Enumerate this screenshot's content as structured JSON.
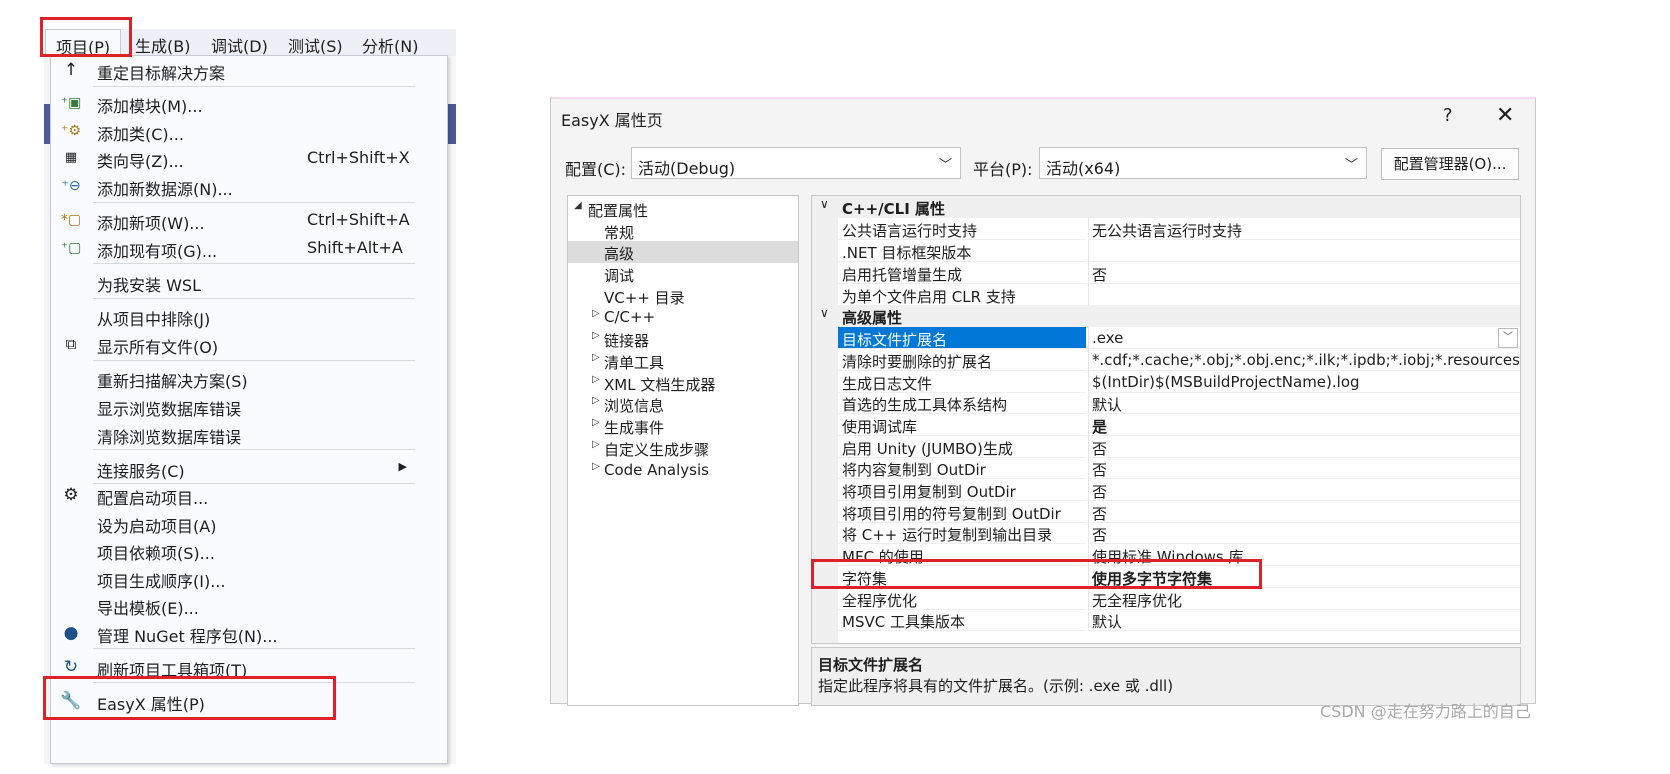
{
  "menubar": {
    "items": [
      "项目(P)",
      "生成(B)",
      "调试(D)",
      "测试(S)",
      "分析(N)"
    ]
  },
  "menu": {
    "items": [
      {
        "label": "重定目标解决方案",
        "shortcut": "",
        "icon": "arrow-up-icon"
      },
      {
        "label": "添加模块(M)...",
        "shortcut": "",
        "icon": "add-module-icon"
      },
      {
        "label": "添加类(C)...",
        "shortcut": "",
        "icon": "add-class-icon"
      },
      {
        "label": "类向导(Z)...",
        "shortcut": "Ctrl+Shift+X",
        "icon": "class-wizard-icon"
      },
      {
        "label": "添加新数据源(N)...",
        "shortcut": "",
        "icon": "add-datasource-icon"
      },
      {
        "label": "添加新项(W)...",
        "shortcut": "Ctrl+Shift+A",
        "icon": "add-new-item-icon"
      },
      {
        "label": "添加现有项(G)...",
        "shortcut": "Shift+Alt+A",
        "icon": "add-existing-item-icon"
      },
      {
        "label": "为我安装 WSL",
        "shortcut": "",
        "icon": ""
      },
      {
        "label": "从项目中排除(J)",
        "shortcut": "",
        "icon": ""
      },
      {
        "label": "显示所有文件(O)",
        "shortcut": "",
        "icon": "show-all-files-icon"
      },
      {
        "label": "重新扫描解决方案(S)",
        "shortcut": "",
        "icon": ""
      },
      {
        "label": "显示浏览数据库错误",
        "shortcut": "",
        "icon": ""
      },
      {
        "label": "清除浏览数据库错误",
        "shortcut": "",
        "icon": ""
      },
      {
        "label": "连接服务(C)",
        "shortcut": "",
        "icon": ""
      },
      {
        "label": "配置启动项目...",
        "shortcut": "",
        "icon": "gear-icon"
      },
      {
        "label": "设为启动项目(A)",
        "shortcut": "",
        "icon": ""
      },
      {
        "label": "项目依赖项(S)...",
        "shortcut": "",
        "icon": ""
      },
      {
        "label": "项目生成顺序(I)...",
        "shortcut": "",
        "icon": ""
      },
      {
        "label": "导出模板(E)...",
        "shortcut": "",
        "icon": ""
      },
      {
        "label": "管理 NuGet 程序包(N)...",
        "shortcut": "",
        "icon": "nuget-icon"
      },
      {
        "label": "刷新项目工具箱项(T)",
        "shortcut": "",
        "icon": "refresh-icon"
      },
      {
        "label": "EasyX 属性(P)",
        "shortcut": "",
        "icon": "wrench-icon"
      }
    ]
  },
  "dialog": {
    "title": "EasyX 属性页",
    "help": "?",
    "close": "✕",
    "config_label": "配置(C):",
    "config_value": "活动(Debug)",
    "platform_label": "平台(P):",
    "platform_value": "活动(x64)",
    "config_manager": "配置管理器(O)...",
    "tree": [
      {
        "label": "配置属性",
        "expander": "◢"
      },
      {
        "label": "常规",
        "expander": ""
      },
      {
        "label": "高级",
        "expander": ""
      },
      {
        "label": "调试",
        "expander": ""
      },
      {
        "label": "VC++ 目录",
        "expander": ""
      },
      {
        "label": "C/C++",
        "expander": "▷"
      },
      {
        "label": "链接器",
        "expander": "▷"
      },
      {
        "label": "清单工具",
        "expander": "▷"
      },
      {
        "label": "XML 文档生成器",
        "expander": "▷"
      },
      {
        "label": "浏览信息",
        "expander": "▷"
      },
      {
        "label": "生成事件",
        "expander": "▷"
      },
      {
        "label": "自定义生成步骤",
        "expander": "▷"
      },
      {
        "label": "Code Analysis",
        "expander": "▷"
      }
    ],
    "grid": {
      "cat1": "C++/CLI 属性",
      "cat1_rows": [
        {
          "name": "公共语言运行时支持",
          "value": "无公共语言运行时支持"
        },
        {
          "name": ".NET 目标框架版本",
          "value": ""
        },
        {
          "name": "启用托管增量生成",
          "value": "否"
        },
        {
          "name": "为单个文件启用 CLR 支持",
          "value": ""
        }
      ],
      "cat2": "高级属性",
      "cat2_rows": [
        {
          "name": "目标文件扩展名",
          "value": ".exe"
        },
        {
          "name": "清除时要删除的扩展名",
          "value": "*.cdf;*.cache;*.obj;*.obj.enc;*.ilk;*.ipdb;*.iobj;*.resources;*.tlb;*"
        },
        {
          "name": "生成日志文件",
          "value": "$(IntDir)$(MSBuildProjectName).log"
        },
        {
          "name": "首选的生成工具体系结构",
          "value": "默认"
        },
        {
          "name": "使用调试库",
          "value": "是"
        },
        {
          "name": "启用 Unity (JUMBO)生成",
          "value": "否"
        },
        {
          "name": "将内容复制到 OutDir",
          "value": "否"
        },
        {
          "name": "将项目引用复制到 OutDir",
          "value": "否"
        },
        {
          "name": "将项目引用的符号复制到 OutDir",
          "value": "否"
        },
        {
          "name": "将 C++ 运行时复制到输出目录",
          "value": "否"
        },
        {
          "name": "MFC 的使用",
          "value": "使用标准 Windows 库"
        },
        {
          "name": "字符集",
          "value": "使用多字节字符集"
        },
        {
          "name": "全程序优化",
          "value": "无全程序优化"
        },
        {
          "name": "MSVC 工具集版本",
          "value": "默认"
        }
      ]
    },
    "description": {
      "title": "目标文件扩展名",
      "text": "指定此程序将具有的文件扩展名。(示例: .exe 或 .dll)"
    }
  },
  "watermark": "CSDN @走在努力路上的自己",
  "colors": {
    "highlight": "#e0202a",
    "selection": "#0078d7"
  }
}
